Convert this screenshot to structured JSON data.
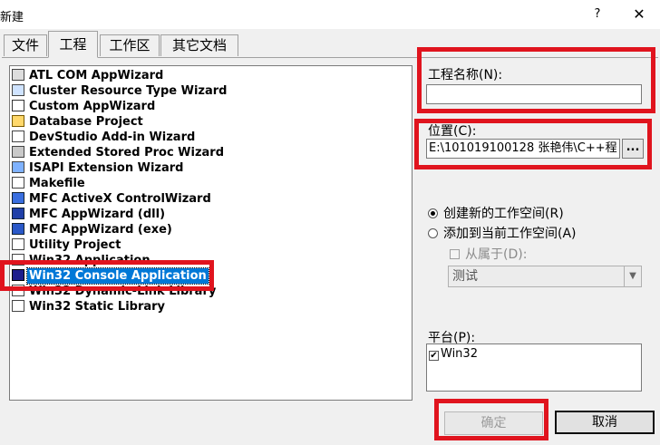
{
  "window": {
    "title": "新建",
    "help_label": "?",
    "close_label": "✕"
  },
  "tabs": [
    {
      "label": "文件"
    },
    {
      "label": "工程"
    },
    {
      "label": "工作区"
    },
    {
      "label": "其它文档"
    }
  ],
  "active_tab": "工程",
  "project_types": [
    {
      "label": "ATL COM AppWizard",
      "icon": "atl-icon"
    },
    {
      "label": "Cluster Resource Type Wizard",
      "icon": "cluster-icon"
    },
    {
      "label": "Custom AppWizard",
      "icon": "custom-appwizard-icon"
    },
    {
      "label": "Database Project",
      "icon": "database-icon"
    },
    {
      "label": "DevStudio Add-in Wizard",
      "icon": "addin-icon"
    },
    {
      "label": "Extended Stored Proc Wizard",
      "icon": "stored-proc-icon"
    },
    {
      "label": "ISAPI Extension Wizard",
      "icon": "isapi-icon"
    },
    {
      "label": "Makefile",
      "icon": "makefile-icon"
    },
    {
      "label": "MFC ActiveX ControlWizard",
      "icon": "activex-icon"
    },
    {
      "label": "MFC AppWizard (dll)",
      "icon": "mfc-dll-icon"
    },
    {
      "label": "MFC AppWizard (exe)",
      "icon": "mfc-exe-icon"
    },
    {
      "label": "Utility Project",
      "icon": "utility-icon"
    },
    {
      "label": "Win32 Application",
      "icon": "win32-app-icon"
    },
    {
      "label": "Win32 Console Application",
      "icon": "win32-console-icon"
    },
    {
      "label": "Win32 Dynamic-Link Library",
      "icon": "win32-dll-icon"
    },
    {
      "label": "Win32 Static Library",
      "icon": "win32-lib-icon"
    }
  ],
  "selected_project_type": "Win32 Console Application",
  "project_name": {
    "label": "工程名称(N):",
    "value": ""
  },
  "location": {
    "label": "位置(C):",
    "value": "E:\\101019100128 张艳伟\\C++程",
    "browse_label": "..."
  },
  "workspace": {
    "create_new_label": "创建新的工作空间(R)",
    "add_to_current_label": "添加到当前工作空间(A)",
    "dependency_label": "从属于(D):",
    "dependency_value": "测试",
    "selected": "create_new"
  },
  "platforms": {
    "label": "平台(P):",
    "items": [
      {
        "label": "Win32",
        "checked": true
      }
    ]
  },
  "buttons": {
    "ok_label": "确定",
    "cancel_label": "取消"
  },
  "colors": {
    "highlight": "#e0141e",
    "selection": "#0078d7"
  }
}
